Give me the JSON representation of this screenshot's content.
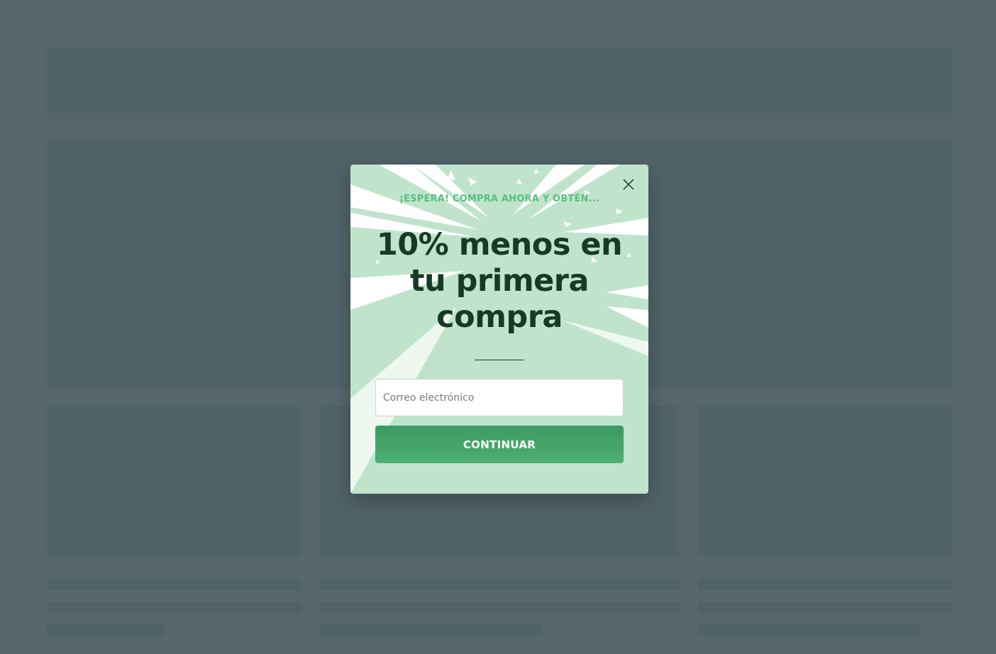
{
  "popup": {
    "eyebrow": "¡ESPERA! COMPRA AHORA Y OBTÉN...",
    "headline": "10% menos en tu primera compra",
    "email_placeholder": "Correo electrónico",
    "email_value": "",
    "cta_label": "CONTINUAR",
    "close_icon": "close-icon"
  },
  "colors": {
    "overlay": "#56686e",
    "popup_bg": "#bfe4cb",
    "eyebrow": "#55c07e",
    "headline": "#173a24",
    "button": "#44a466"
  }
}
